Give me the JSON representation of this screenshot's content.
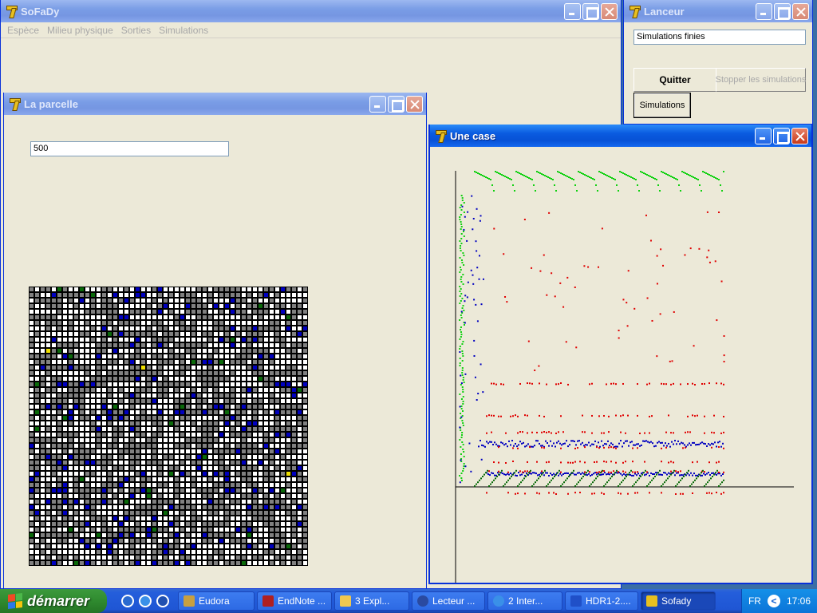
{
  "windows": {
    "main": {
      "title": "SoFaDy",
      "menu": [
        "Espèce",
        "Milieu physique",
        "Sorties",
        "Simulations"
      ]
    },
    "launcher": {
      "title": "Lanceur",
      "status_value": "Simulations finies",
      "quit_label": "Quitter",
      "stop_label": "Stopper les simulations",
      "simulations_label": "Simulations"
    },
    "parcel": {
      "title": "La parcelle",
      "step_value": "500"
    },
    "cell": {
      "title": "Une case"
    }
  },
  "colors": {
    "blue": "#0000c0",
    "green": "#10d010",
    "dark_green": "#0a6a0a",
    "red": "#e00000",
    "gray": "#808080"
  },
  "taskbar": {
    "start_label": "démarrer",
    "tasks": [
      "Eudora",
      "EndNote ...",
      "3 Expl...",
      "Lecteur ...",
      "2 Inter...",
      "HDR1-2....",
      "Sofady"
    ],
    "lang": "FR",
    "clock": "17:06"
  }
}
